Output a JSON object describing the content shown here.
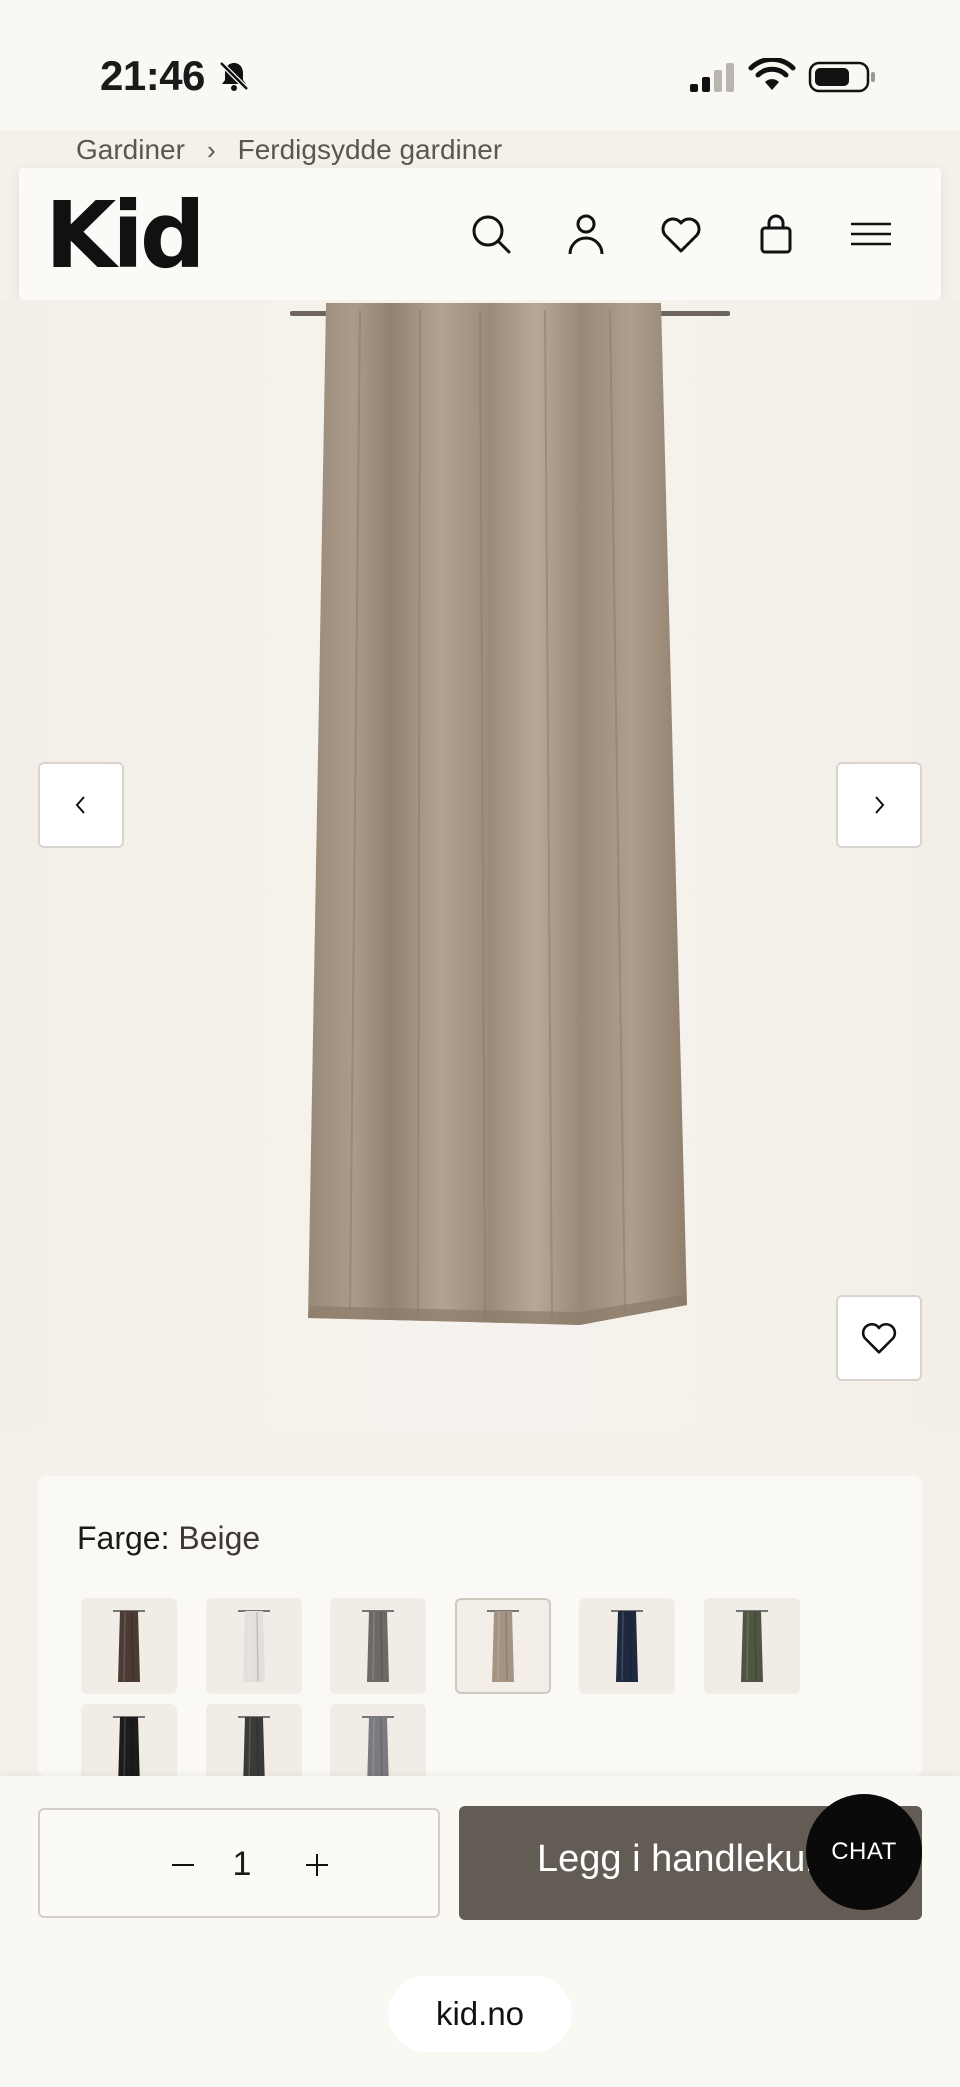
{
  "status_bar": {
    "time": "21:46",
    "icons": [
      "bell-slash-icon",
      "cellular-signal-icon",
      "wifi-icon",
      "battery-icon"
    ]
  },
  "breadcrumb": {
    "items": [
      "Gardiner",
      "Ferdigsydde gardiner"
    ],
    "separator": "›"
  },
  "header": {
    "logo": "Kid",
    "icons": [
      "search-icon",
      "account-icon",
      "wishlist-heart-icon",
      "shopping-bag-icon",
      "menu-icon"
    ]
  },
  "gallery": {
    "prev_icon": "chevron-left-icon",
    "next_icon": "chevron-right-icon",
    "favorite_icon": "heart-icon",
    "product_color": "#a59484"
  },
  "color_picker": {
    "label": "Farge:",
    "selected_value": "Beige",
    "swatches": [
      {
        "color": "#4a3b33",
        "selected": false
      },
      {
        "color": "#e2e0dc",
        "selected": false
      },
      {
        "color": "#6d6a66",
        "selected": false
      },
      {
        "color": "#a59484",
        "selected": true
      },
      {
        "color": "#1e2940",
        "selected": false
      },
      {
        "color": "#4f5443",
        "selected": false
      },
      {
        "color": "#1c1c1c",
        "selected": false
      },
      {
        "color": "#3a3a38",
        "selected": false
      },
      {
        "color": "#7b7a80",
        "selected": false
      }
    ]
  },
  "cart": {
    "quantity": "1",
    "minus_icon": "minus-icon",
    "plus_icon": "plus-icon",
    "add_label": "Legg i handlekurv",
    "chat_label": "CHAT"
  },
  "browser": {
    "url": "kid.no"
  },
  "colors": {
    "page_bg": "#f5f1ea",
    "button_bg": "#635c55",
    "chat_bg": "#0a0a0a"
  }
}
